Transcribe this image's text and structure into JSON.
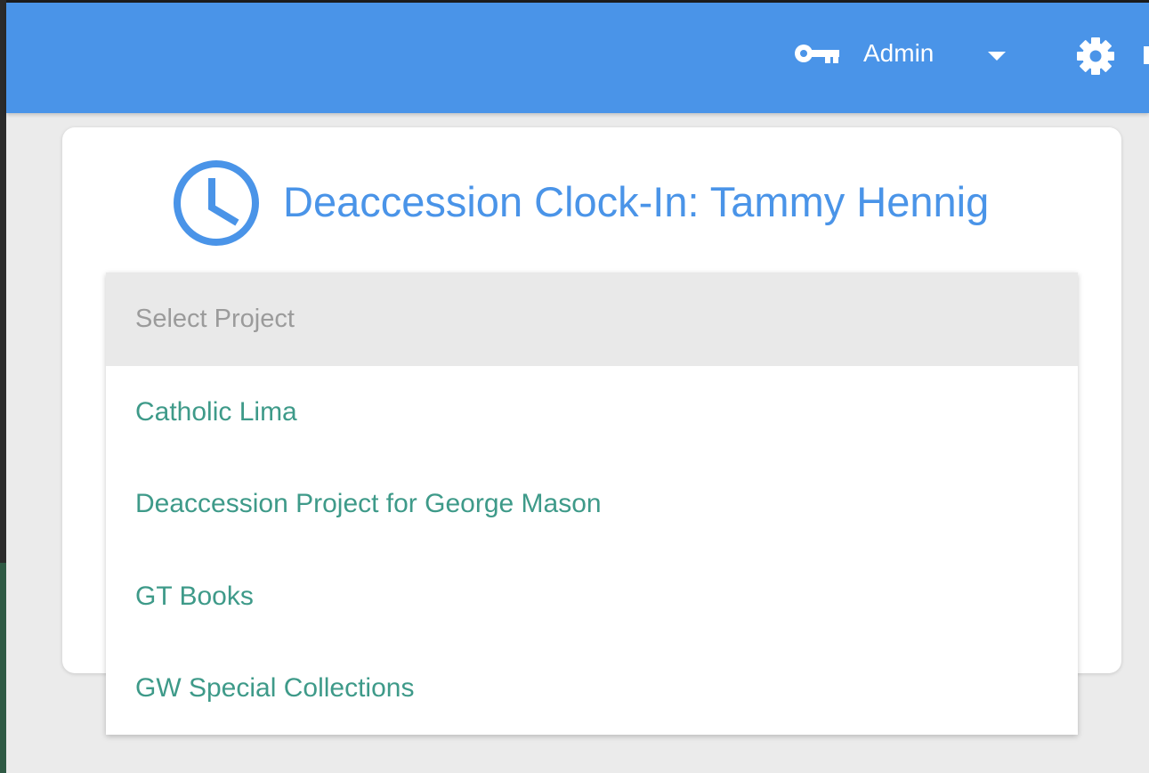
{
  "header": {
    "role_label": "Admin",
    "icons": [
      "key-icon",
      "caret-down-icon",
      "gear-icon"
    ],
    "bar_color": "#4a94e8"
  },
  "card": {
    "title": "Deaccession Clock-In: Tammy Hennig",
    "icon": "clock-icon"
  },
  "project_select": {
    "placeholder": "Select Project",
    "options": [
      "Catholic Lima",
      "Deaccession Project for George Mason",
      "GT Books",
      "GW Special Collections"
    ],
    "option_color": "#3e9a89"
  }
}
